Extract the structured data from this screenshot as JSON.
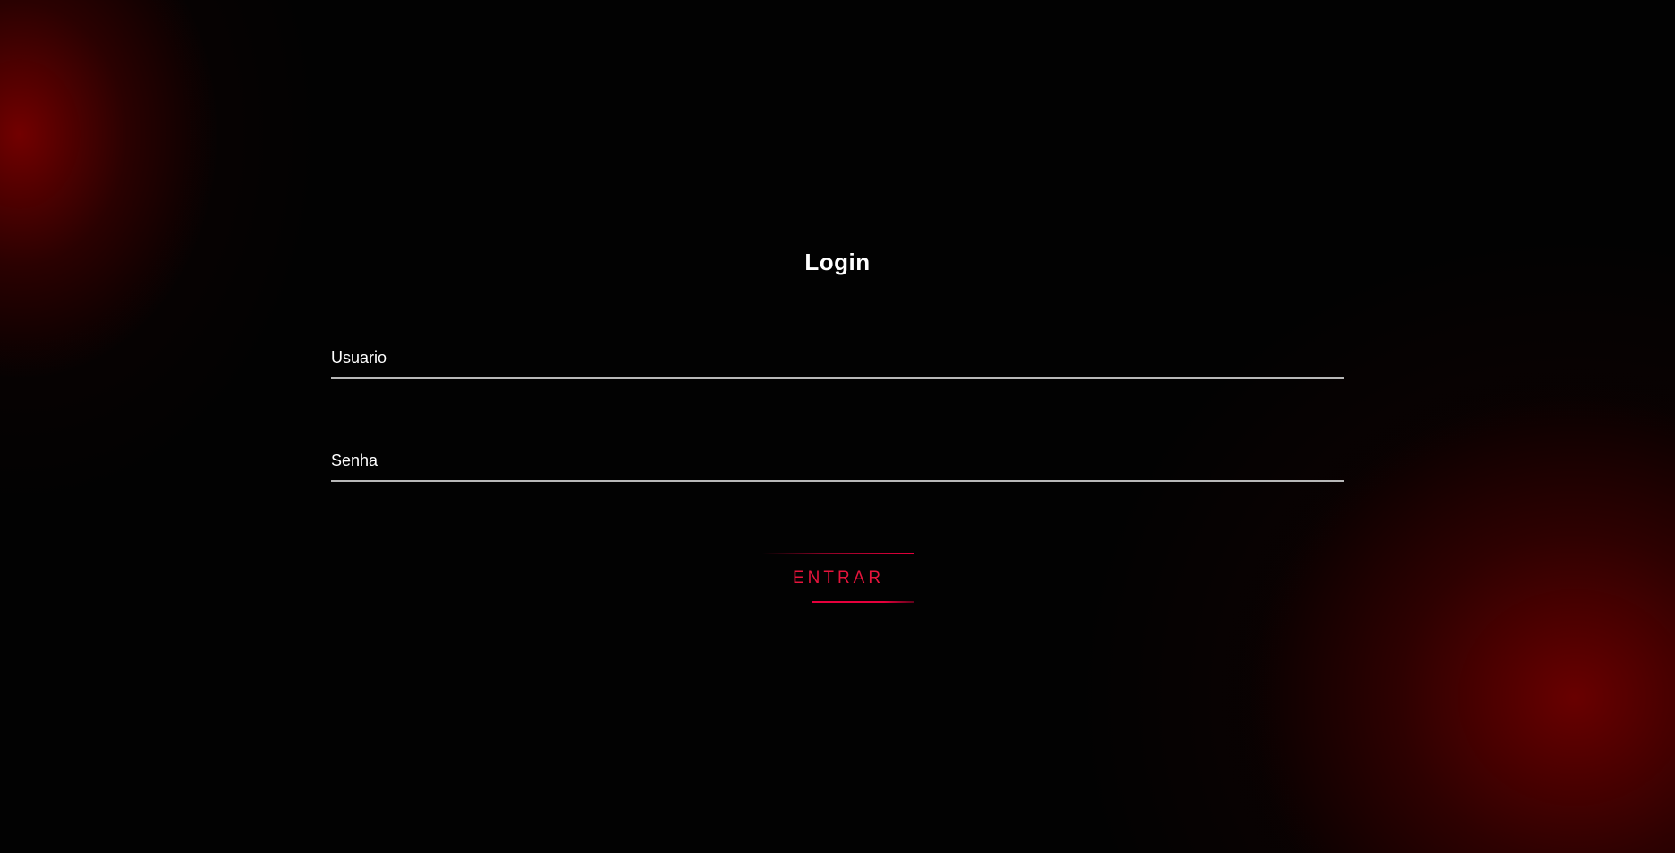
{
  "login": {
    "title": "Login",
    "username": {
      "label": "Usuario",
      "value": ""
    },
    "password": {
      "label": "Senha",
      "value": ""
    },
    "submit_label": "ENTRAR"
  },
  "colors": {
    "background": "#000000",
    "accent": "#e6003c",
    "glow": "#7a0000",
    "text": "#ffffff",
    "underline": "#b8b8b8"
  }
}
